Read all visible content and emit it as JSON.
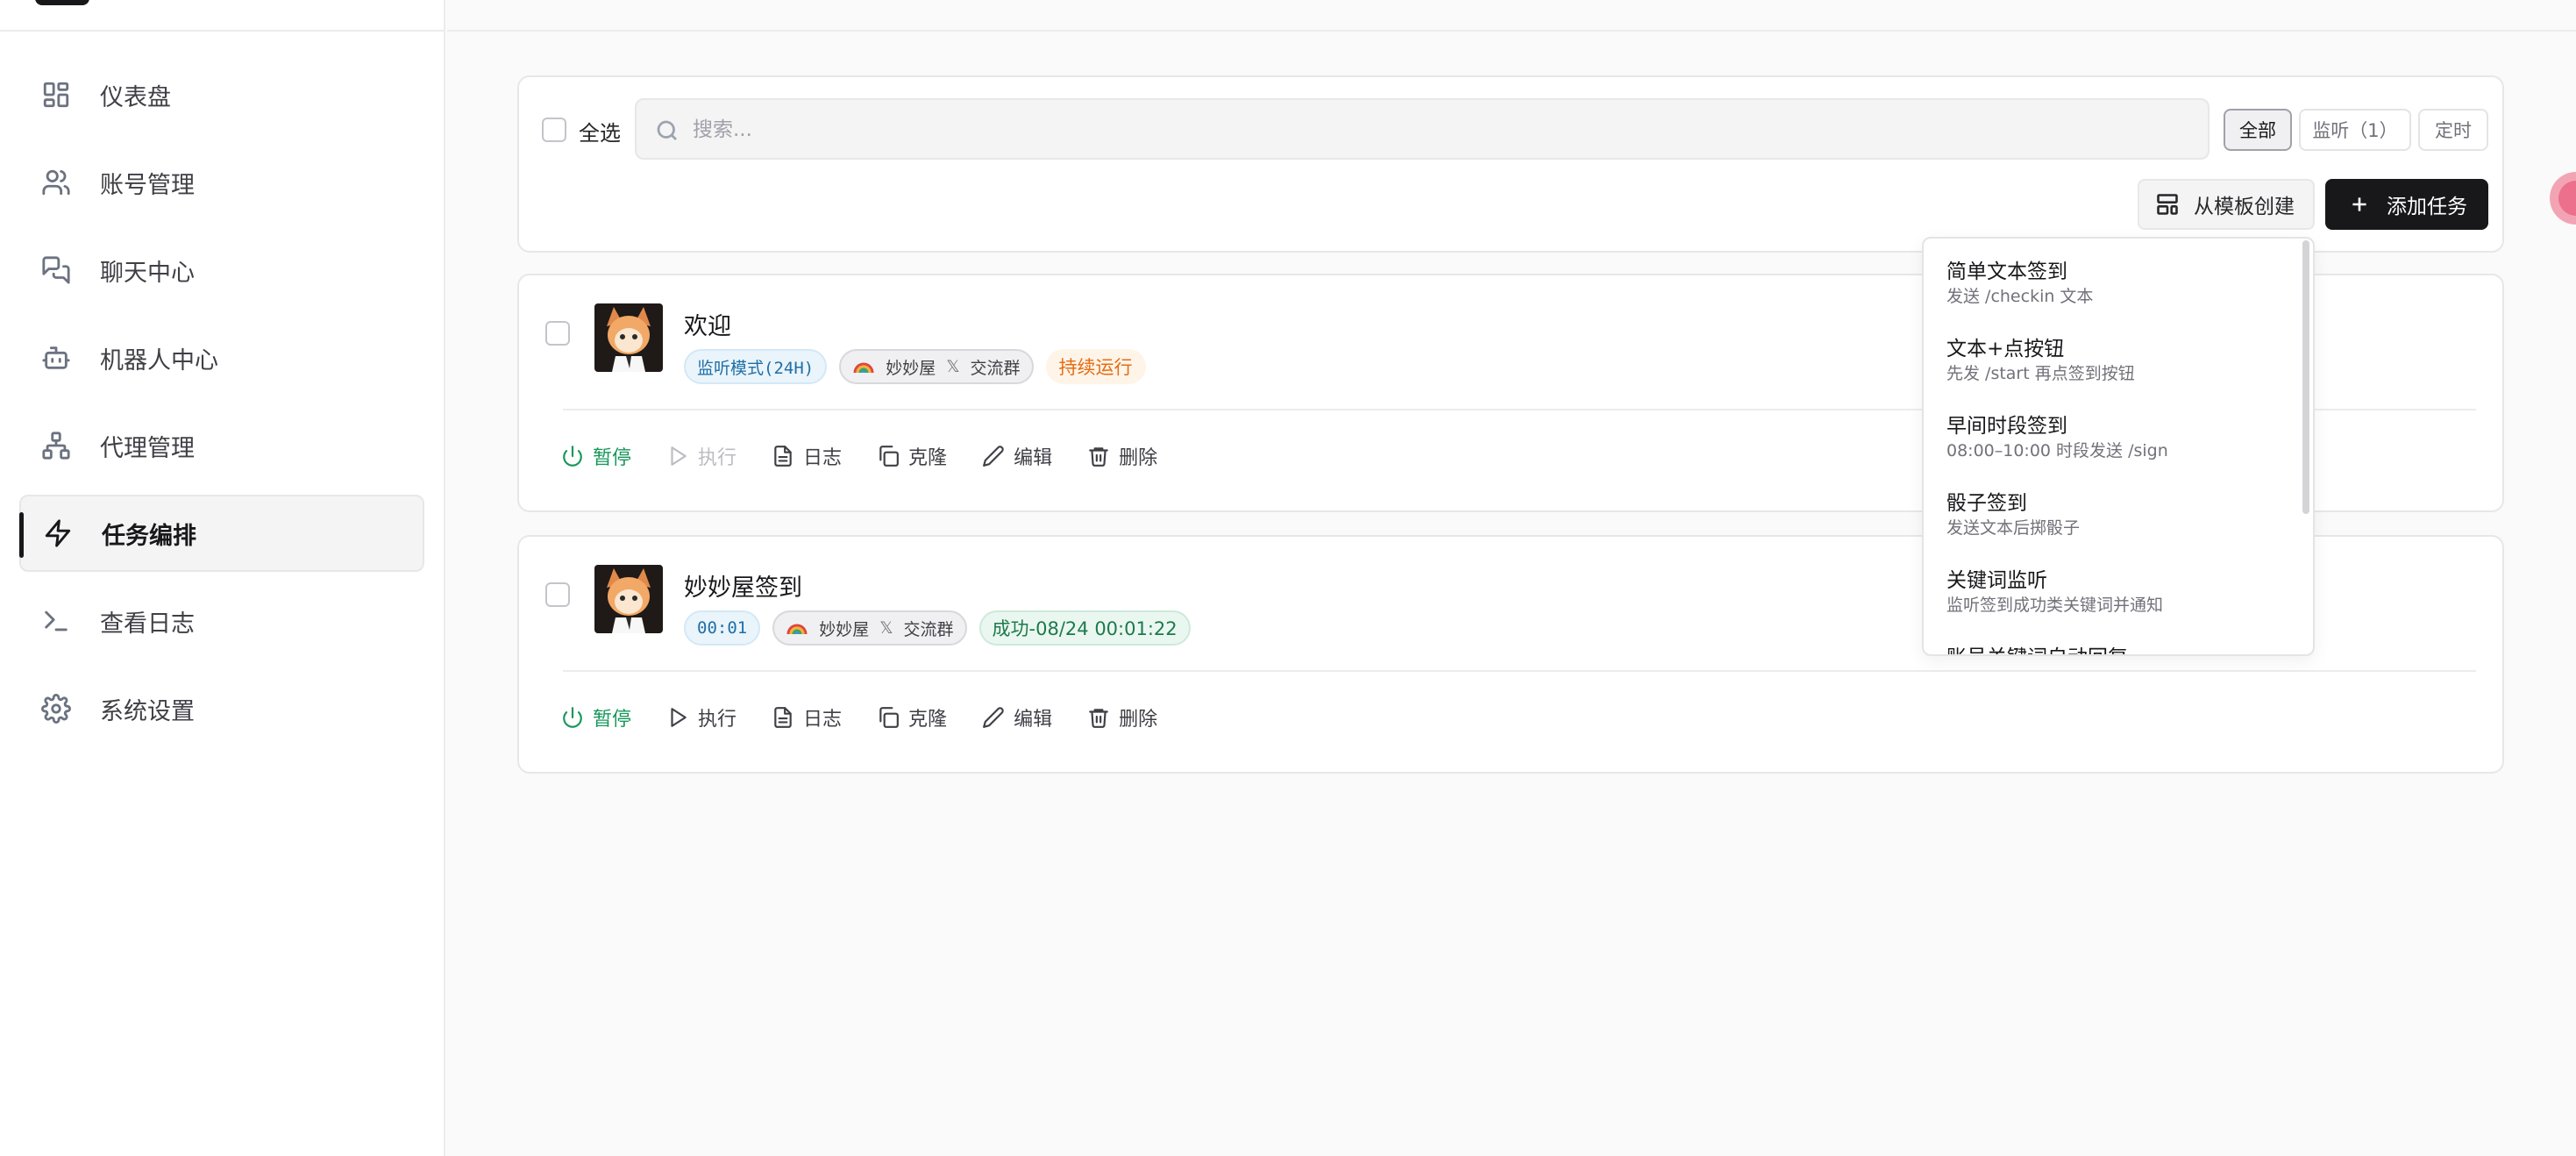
{
  "sidebar": {
    "items": [
      {
        "label": "仪表盘",
        "icon": "dashboard-icon"
      },
      {
        "label": "账号管理",
        "icon": "users-icon"
      },
      {
        "label": "聊天中心",
        "icon": "chat-icon"
      },
      {
        "label": "机器人中心",
        "icon": "bot-icon"
      },
      {
        "label": "代理管理",
        "icon": "network-icon"
      },
      {
        "label": "任务编排",
        "icon": "lightning-icon",
        "active": true
      },
      {
        "label": "查看日志",
        "icon": "terminal-icon"
      },
      {
        "label": "系统设置",
        "icon": "gear-icon"
      }
    ]
  },
  "toolbar": {
    "select_all": "全选",
    "search_placeholder": "搜索...",
    "filters": [
      "全部",
      "监听（1）",
      "定时"
    ],
    "template_button": "从模板创建",
    "add_button": "添加任务"
  },
  "tasks": [
    {
      "title": "欢迎",
      "tags": {
        "mode": "监听模式(24H)",
        "account": "妙妙屋",
        "channel": "交流群",
        "status": "持续运行"
      },
      "actions": {
        "pause": "暂停",
        "run": "执行",
        "log": "日志",
        "clone": "克隆",
        "edit": "编辑",
        "delete": "删除"
      }
    },
    {
      "title": "妙妙屋签到",
      "tags": {
        "mode": "00:01",
        "account": "妙妙屋",
        "channel": "交流群",
        "status": "成功-08/24 00:01:22"
      },
      "actions": {
        "pause": "暂停",
        "run": "执行",
        "log": "日志",
        "clone": "克隆",
        "edit": "编辑",
        "delete": "删除"
      }
    }
  ],
  "separator": "𝕏",
  "templates": [
    {
      "title": "简单文本签到",
      "desc": "发送 /checkin 文本"
    },
    {
      "title": "文本+点按钮",
      "desc": "先发 /start 再点签到按钮"
    },
    {
      "title": "早间时段签到",
      "desc": "08:00–10:00 时段发送 /sign"
    },
    {
      "title": "骰子签到",
      "desc": "发送文本后掷骰子"
    },
    {
      "title": "关键词监听",
      "desc": "监听签到成功类关键词并通知"
    },
    {
      "title": "账号关键词自动回复",
      "desc": ""
    }
  ],
  "colors": {
    "accent": "#18181b",
    "success": "#16975a",
    "warning": "#e66b12",
    "info": "#1f6fa6"
  }
}
